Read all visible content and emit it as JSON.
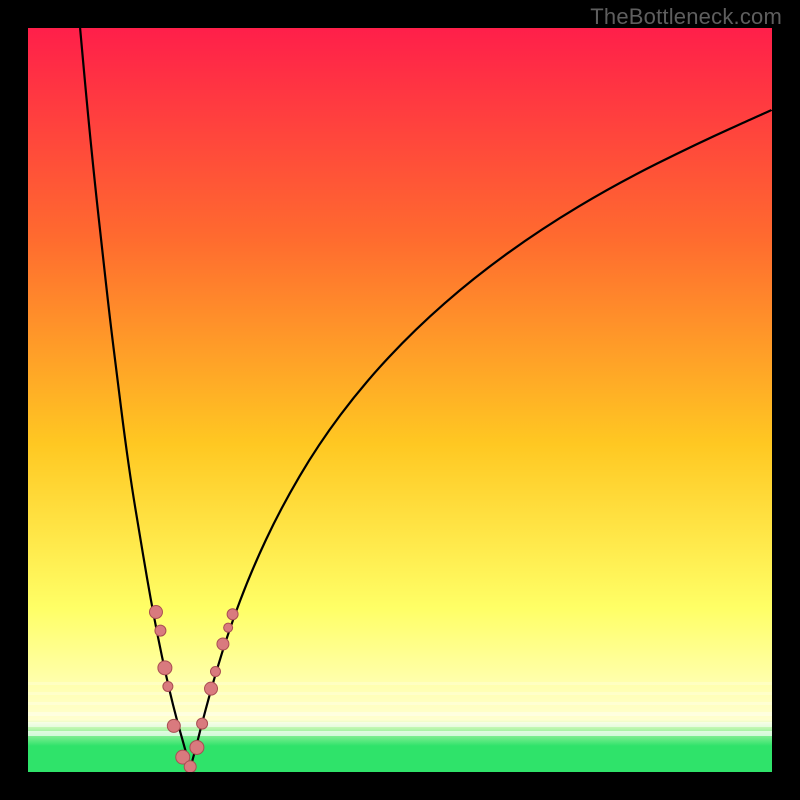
{
  "watermark": "TheBottleneck.com",
  "colors": {
    "frame": "#000000",
    "curve": "#000000",
    "marker_fill": "#d97a7e",
    "marker_stroke": "#a94e53",
    "grad_top": "#ff1f4a",
    "grad_mid_upper": "#ff6a2f",
    "grad_mid": "#ffc822",
    "grad_low": "#ffff66",
    "grad_pale": "#ffffd0",
    "grad_green": "#2fe36a"
  },
  "chart_data": {
    "type": "line",
    "title": "",
    "xlabel": "",
    "ylabel": "",
    "xlim": [
      0,
      100
    ],
    "ylim": [
      0,
      100
    ],
    "curve_left": {
      "x": [
        7,
        8,
        9,
        10,
        11,
        12,
        13,
        14,
        15,
        16,
        17,
        18,
        19,
        20,
        21,
        21.8
      ],
      "y": [
        100,
        89,
        79,
        70,
        61,
        53,
        45,
        38,
        32,
        26,
        20.5,
        15.5,
        11,
        7,
        3.5,
        0.5
      ]
    },
    "curve_right": {
      "x": [
        21.8,
        22.5,
        23.5,
        25,
        27,
        30,
        34,
        39,
        45,
        52,
        60,
        69,
        79,
        90,
        100
      ],
      "y": [
        0.5,
        3,
        7,
        12.5,
        19,
        27,
        35.5,
        44,
        52,
        59.5,
        66.5,
        73,
        79,
        84.5,
        89
      ]
    },
    "markers": [
      {
        "x": 17.2,
        "y": 21.5,
        "r": 6.5
      },
      {
        "x": 17.8,
        "y": 19.0,
        "r": 5.5
      },
      {
        "x": 18.4,
        "y": 14.0,
        "r": 7.0
      },
      {
        "x": 18.8,
        "y": 11.5,
        "r": 5.0
      },
      {
        "x": 19.6,
        "y": 6.2,
        "r": 6.5
      },
      {
        "x": 20.8,
        "y": 2.0,
        "r": 7.0
      },
      {
        "x": 21.8,
        "y": 0.7,
        "r": 6.0
      },
      {
        "x": 22.7,
        "y": 3.3,
        "r": 7.0
      },
      {
        "x": 23.4,
        "y": 6.5,
        "r": 5.5
      },
      {
        "x": 24.6,
        "y": 11.2,
        "r": 6.5
      },
      {
        "x": 25.2,
        "y": 13.5,
        "r": 5.0
      },
      {
        "x": 26.2,
        "y": 17.2,
        "r": 6.0
      },
      {
        "x": 26.9,
        "y": 19.4,
        "r": 4.5
      },
      {
        "x": 27.5,
        "y": 21.2,
        "r": 5.5
      }
    ],
    "gradient_stops": [
      {
        "offset": 0.0,
        "key": "grad_top"
      },
      {
        "offset": 0.28,
        "key": "grad_mid_upper"
      },
      {
        "offset": 0.56,
        "key": "grad_mid"
      },
      {
        "offset": 0.78,
        "key": "grad_low"
      },
      {
        "offset": 0.93,
        "key": "grad_pale"
      },
      {
        "offset": 0.965,
        "key": "grad_green"
      },
      {
        "offset": 1.0,
        "key": "grad_green"
      }
    ]
  }
}
